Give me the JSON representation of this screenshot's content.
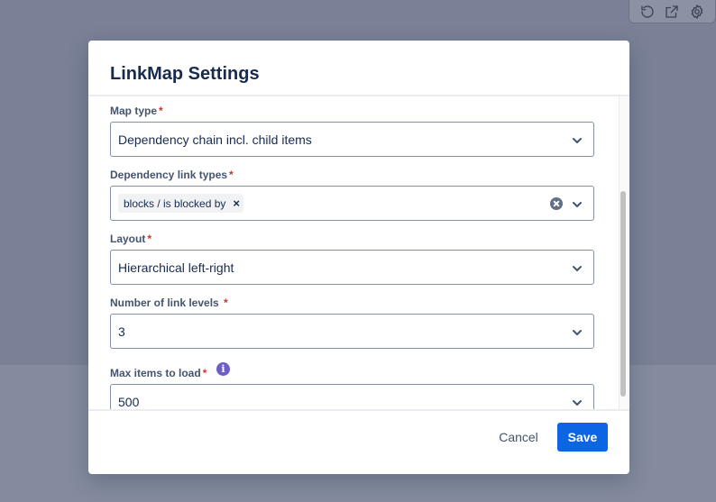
{
  "toolbar": {
    "icons": [
      "refresh-icon",
      "external-link-icon",
      "gear-icon"
    ]
  },
  "modal": {
    "title": "LinkMap Settings",
    "fields": {
      "map_type": {
        "label": "Map type",
        "required_mark": "*",
        "value": "Dependency chain incl. child items"
      },
      "link_types": {
        "label": "Dependency link types",
        "required_mark": "*",
        "chips": [
          "blocks / is blocked by"
        ],
        "chip_remove": "×"
      },
      "layout": {
        "label": "Layout",
        "required_mark": "*",
        "value": "Hierarchical left-right"
      },
      "link_levels": {
        "label": "Number of link levels",
        "required_mark": "*",
        "value": "3"
      },
      "max_items": {
        "label": "Max items to load",
        "required_mark": "*",
        "info": "i",
        "value": "500"
      }
    },
    "footer": {
      "cancel_label": "Cancel",
      "save_label": "Save"
    }
  },
  "colors": {
    "primary": "#0C66E4",
    "required": "#C9372C",
    "info": "#6E5DC6",
    "overlay": "#7a8196"
  }
}
